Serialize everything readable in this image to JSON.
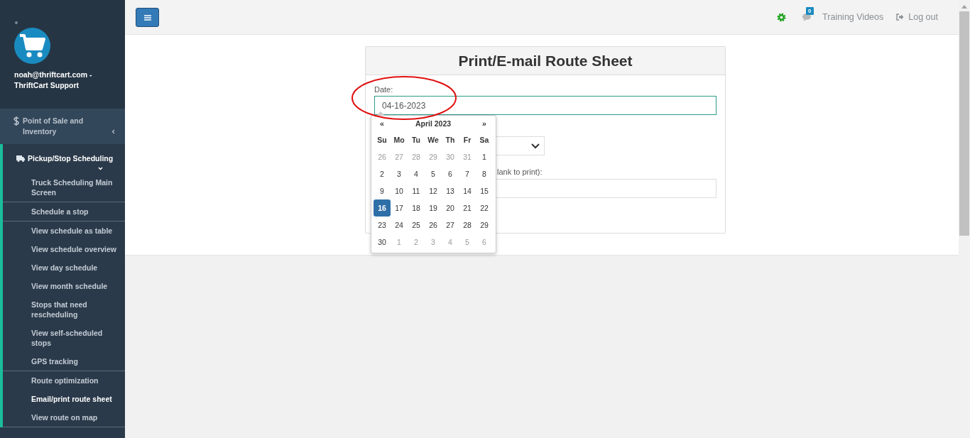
{
  "sidebar": {
    "user": "noah@thriftcart.com - ThriftCart Support",
    "sections": [
      {
        "label": "Point of Sale and Inventory",
        "expanded": false
      },
      {
        "label": "Pickup/Stop Scheduling",
        "expanded": true,
        "items": [
          {
            "label": "Truck Scheduling Main Screen",
            "selected": false,
            "separator_below": true
          },
          {
            "label": "Schedule a stop",
            "selected": false,
            "separator_below": true
          },
          {
            "label": "View schedule as table",
            "selected": false,
            "separator_below": false
          },
          {
            "label": "View schedule overview",
            "selected": false,
            "separator_below": false
          },
          {
            "label": "View day schedule",
            "selected": false,
            "separator_below": false
          },
          {
            "label": "View month schedule",
            "selected": false,
            "separator_below": false
          },
          {
            "label": "Stops that need rescheduling",
            "selected": false,
            "separator_below": false
          },
          {
            "label": "View self-scheduled stops",
            "selected": false,
            "separator_below": false
          },
          {
            "label": "GPS tracking",
            "selected": false,
            "separator_below": true
          },
          {
            "label": "Route optimization",
            "selected": false,
            "separator_below": false
          },
          {
            "label": "Email/print route sheet",
            "selected": true,
            "separator_below": false
          },
          {
            "label": "View route on map",
            "selected": false,
            "separator_below": true
          }
        ]
      }
    ]
  },
  "topbar": {
    "message_count": "0",
    "links": [
      {
        "label": "Training Videos"
      },
      {
        "label": "Log out"
      }
    ]
  },
  "panel": {
    "title": "Print/E-mail Route Sheet",
    "date_label": "Date:",
    "date_value": "04-16-2023",
    "email_label_visible_part": "lank to print):"
  },
  "datepicker": {
    "prev": "«",
    "month": "April 2023",
    "next": "»",
    "weekdays": [
      "Su",
      "Mo",
      "Tu",
      "We",
      "Th",
      "Fr",
      "Sa"
    ],
    "days": [
      {
        "day": "26",
        "other_month": true,
        "selected": false
      },
      {
        "day": "27",
        "other_month": true,
        "selected": false
      },
      {
        "day": "28",
        "other_month": true,
        "selected": false
      },
      {
        "day": "29",
        "other_month": true,
        "selected": false
      },
      {
        "day": "30",
        "other_month": true,
        "selected": false
      },
      {
        "day": "31",
        "other_month": true,
        "selected": false
      },
      {
        "day": "1",
        "other_month": false,
        "selected": false
      },
      {
        "day": "2",
        "other_month": false,
        "selected": false
      },
      {
        "day": "3",
        "other_month": false,
        "selected": false
      },
      {
        "day": "4",
        "other_month": false,
        "selected": false
      },
      {
        "day": "5",
        "other_month": false,
        "selected": false
      },
      {
        "day": "6",
        "other_month": false,
        "selected": false
      },
      {
        "day": "7",
        "other_month": false,
        "selected": false
      },
      {
        "day": "8",
        "other_month": false,
        "selected": false
      },
      {
        "day": "9",
        "other_month": false,
        "selected": false
      },
      {
        "day": "10",
        "other_month": false,
        "selected": false
      },
      {
        "day": "11",
        "other_month": false,
        "selected": false
      },
      {
        "day": "12",
        "other_month": false,
        "selected": false
      },
      {
        "day": "13",
        "other_month": false,
        "selected": false
      },
      {
        "day": "14",
        "other_month": false,
        "selected": false
      },
      {
        "day": "15",
        "other_month": false,
        "selected": false
      },
      {
        "day": "16",
        "other_month": false,
        "selected": true
      },
      {
        "day": "17",
        "other_month": false,
        "selected": false
      },
      {
        "day": "18",
        "other_month": false,
        "selected": false
      },
      {
        "day": "19",
        "other_month": false,
        "selected": false
      },
      {
        "day": "20",
        "other_month": false,
        "selected": false
      },
      {
        "day": "21",
        "other_month": false,
        "selected": false
      },
      {
        "day": "22",
        "other_month": false,
        "selected": false
      },
      {
        "day": "23",
        "other_month": false,
        "selected": false
      },
      {
        "day": "24",
        "other_month": false,
        "selected": false
      },
      {
        "day": "25",
        "other_month": false,
        "selected": false
      },
      {
        "day": "26",
        "other_month": false,
        "selected": false
      },
      {
        "day": "27",
        "other_month": false,
        "selected": false
      },
      {
        "day": "28",
        "other_month": false,
        "selected": false
      },
      {
        "day": "29",
        "other_month": false,
        "selected": false
      },
      {
        "day": "30",
        "other_month": false,
        "selected": false
      },
      {
        "day": "1",
        "other_month": true,
        "selected": false
      },
      {
        "day": "2",
        "other_month": true,
        "selected": false
      },
      {
        "day": "3",
        "other_month": true,
        "selected": false
      },
      {
        "day": "4",
        "other_month": true,
        "selected": false
      },
      {
        "day": "5",
        "other_month": true,
        "selected": false
      },
      {
        "day": "6",
        "other_month": true,
        "selected": false
      }
    ]
  }
}
